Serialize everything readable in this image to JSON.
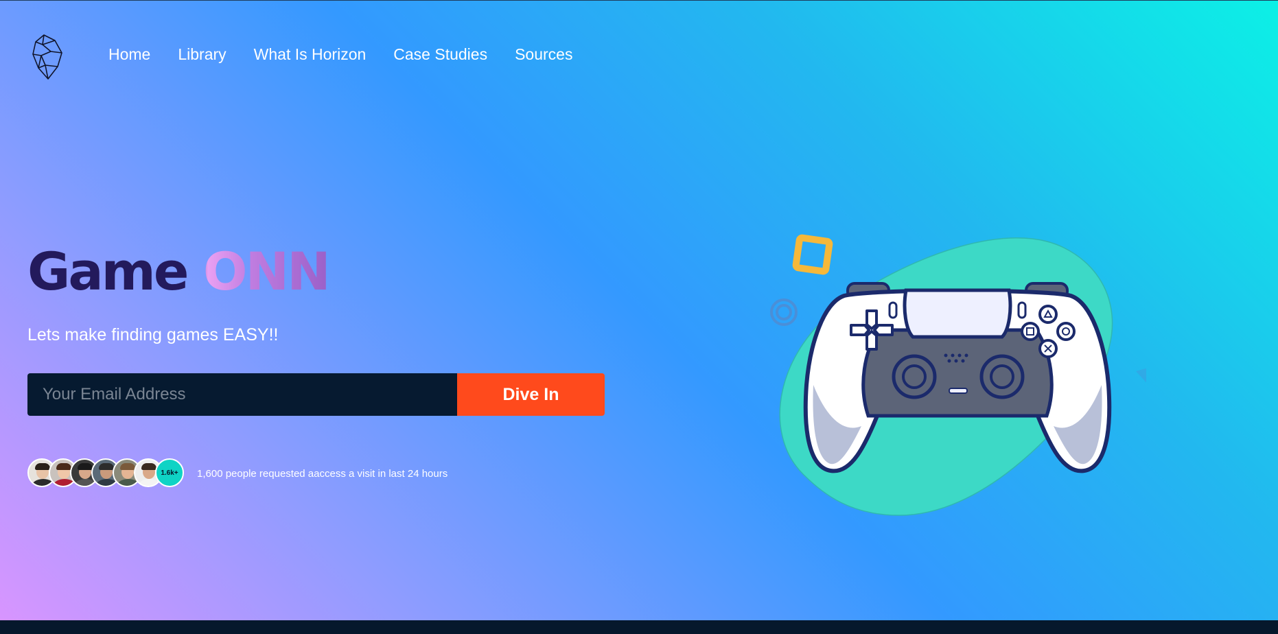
{
  "nav": {
    "items": [
      {
        "label": "Home"
      },
      {
        "label": "Library"
      },
      {
        "label": "What Is Horizon"
      },
      {
        "label": "Case Studies"
      },
      {
        "label": "Sources"
      }
    ]
  },
  "hero": {
    "title_word1": "Game",
    "title_word2": " ONN",
    "subtitle": "Lets make finding games EASY!!",
    "email_placeholder": "Your Email Address",
    "cta_label": "Dive In",
    "avatar_count_badge": "1.6k+",
    "requests_text": "1,600 people requested aaccess a visit in last 24 hours"
  },
  "colors": {
    "cta": "#ff4a1c",
    "input_bg": "#061a30",
    "title_dark": "#231a5c",
    "badge": "#0fd3c5",
    "blob": "#3dd9c6"
  },
  "icons": {
    "logo": "crystal-logo-icon",
    "illustration": "gamepad-illustration"
  }
}
